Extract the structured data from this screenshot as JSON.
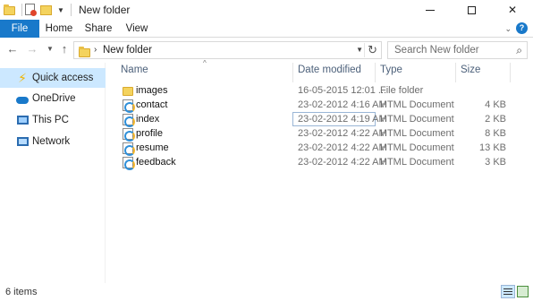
{
  "window": {
    "title": "New folder",
    "controls": {
      "minimize": "minimize",
      "maximize": "maximize",
      "close": "✕"
    }
  },
  "ribbon": {
    "tabs": [
      "File",
      "Home",
      "Share",
      "View"
    ],
    "help": "?"
  },
  "address": {
    "path": "New folder",
    "search_placeholder": "Search New folder"
  },
  "nav_pane": {
    "items": [
      {
        "label": "Quick access",
        "icon": "star-icon",
        "selected": true
      },
      {
        "label": "OneDrive",
        "icon": "cloud-icon",
        "selected": false
      },
      {
        "label": "This PC",
        "icon": "computer-icon",
        "selected": false
      },
      {
        "label": "Network",
        "icon": "network-icon",
        "selected": false
      }
    ]
  },
  "columns": {
    "name": "Name",
    "date": "Date modified",
    "type": "Type",
    "size": "Size"
  },
  "files": [
    {
      "name": "images",
      "date": "16-05-2015 12:01 ...",
      "type": "File folder",
      "size": "",
      "icon": "folder-icon"
    },
    {
      "name": "contact",
      "date": "23-02-2012 4:16 AM",
      "type": "HTML Document",
      "size": "4 KB",
      "icon": "html-file-icon"
    },
    {
      "name": "index",
      "date": "23-02-2012 4:19 AM",
      "type": "HTML Document",
      "size": "2 KB",
      "icon": "html-file-icon"
    },
    {
      "name": "profile",
      "date": "23-02-2012 4:22 AM",
      "type": "HTML Document",
      "size": "8 KB",
      "icon": "html-file-icon"
    },
    {
      "name": "resume",
      "date": "23-02-2012 4:22 AM",
      "type": "HTML Document",
      "size": "13 KB",
      "icon": "html-file-icon"
    },
    {
      "name": "feedback",
      "date": "23-02-2012 4:22 AM",
      "type": "HTML Document",
      "size": "3 KB",
      "icon": "html-file-icon"
    }
  ],
  "status": {
    "item_count": "6 items"
  },
  "colors": {
    "accent": "#1979ca",
    "selection": "#cce8ff",
    "folder": "#f4d35e"
  }
}
